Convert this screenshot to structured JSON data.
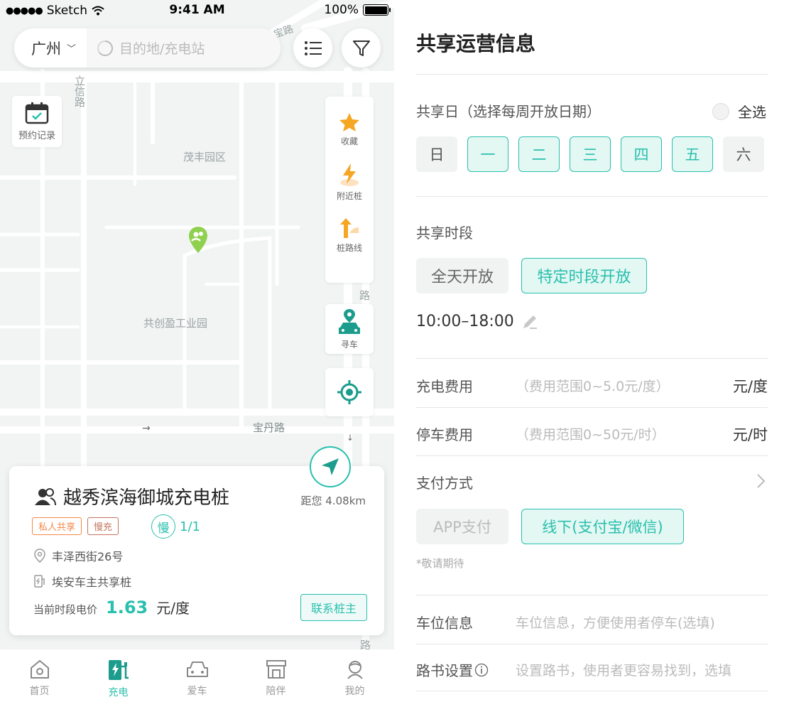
{
  "left": {
    "statusbar": {
      "carrier": "Sketch",
      "time": "9:41 AM",
      "battery": "100%"
    },
    "search": {
      "city": "广州",
      "placeholder": "目的地/充电站"
    },
    "booking_label": "预约记录",
    "tools": {
      "favorite": "收藏",
      "nearby": "附近桩",
      "route": "桩路线"
    },
    "findcar_label": "寻车",
    "map_labels": {
      "lixin_road": "立信路",
      "maofeng_park": "茂丰园区",
      "gongchuang_park": "共创盈工业园",
      "baodan_road": "宝丹路",
      "baoshan_road": "宝路",
      "right_road": "路",
      "bottom_road": "路"
    },
    "card": {
      "title": "越秀滨海御城充电桩",
      "distance": "距您 4.08km",
      "tags": [
        "私人共享",
        "慢充"
      ],
      "slow_badge": "慢",
      "slow_count": "1/1",
      "address": "丰泽西街26号",
      "owner": "埃安车主共享桩",
      "price_label": "当前时段电价",
      "price_value": "1.63",
      "price_unit": "元/度",
      "contact_button": "联系桩主"
    },
    "tabs": [
      {
        "label": "首页",
        "icon": "home-icon",
        "active": false
      },
      {
        "label": "充电",
        "icon": "charge-icon",
        "active": true
      },
      {
        "label": "爱车",
        "icon": "car-icon",
        "active": false
      },
      {
        "label": "陪伴",
        "icon": "shop-icon",
        "active": false
      },
      {
        "label": "我的",
        "icon": "profile-icon",
        "active": false
      }
    ]
  },
  "right": {
    "title": "共享运营信息",
    "share_days": {
      "label": "共享日（选择每周开放日期）",
      "select_all": "全选",
      "days": [
        {
          "label": "日",
          "selected": false
        },
        {
          "label": "一",
          "selected": true
        },
        {
          "label": "二",
          "selected": true
        },
        {
          "label": "三",
          "selected": true
        },
        {
          "label": "四",
          "selected": true
        },
        {
          "label": "五",
          "selected": true
        },
        {
          "label": "六",
          "selected": false
        }
      ]
    },
    "share_time": {
      "label": "共享时段",
      "option_all_day": "全天开放",
      "option_specific": "特定时段开放",
      "range": "10:00–18:00"
    },
    "charge_fee": {
      "label": "充电费用",
      "placeholder": "（费用范围0~5.0元/度）",
      "unit": "元/度"
    },
    "parking_fee": {
      "label": "停车费用",
      "placeholder": "（费用范围0~50元/时）",
      "unit": "元/时"
    },
    "payment": {
      "label": "支付方式",
      "option_app": "APP支付",
      "option_offline": "线下(支付宝/微信)",
      "note": "*敬请期待"
    },
    "parking_info": {
      "label": "车位信息",
      "placeholder": "车位信息，方便使用者停车(选填)"
    },
    "route_setting": {
      "label": "路书设置",
      "placeholder": "设置路书，使用者更容易找到，选填"
    },
    "accent_color": "#29c0ad"
  }
}
